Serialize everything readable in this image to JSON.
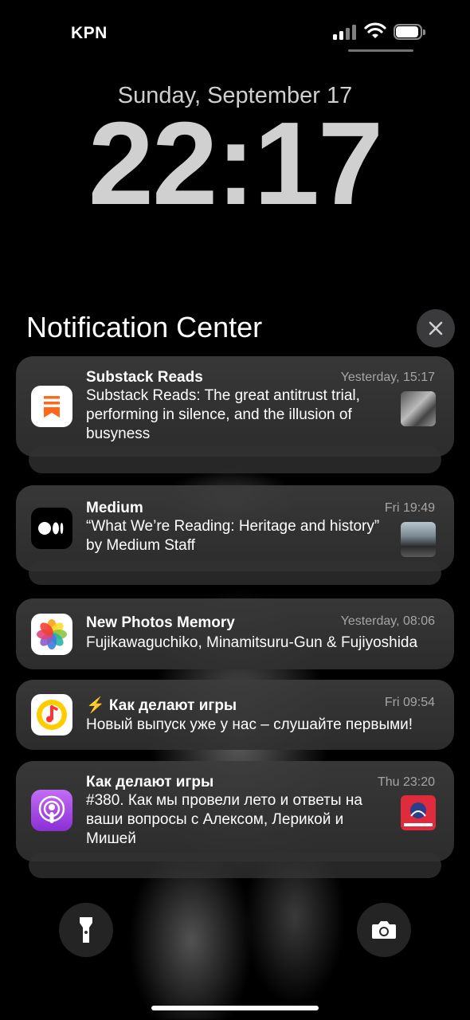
{
  "status_bar": {
    "carrier": "KPN",
    "signal_icon": "cellular-signal-icon",
    "wifi_icon": "wifi-icon",
    "battery_icon": "battery-icon",
    "battery_level": 0.85
  },
  "lock_screen": {
    "date": "Sunday, September 17",
    "time": "22:17"
  },
  "notification_center": {
    "title": "Notification Center",
    "close_icon": "close-icon"
  },
  "notifications": [
    {
      "app": "Substack Reads",
      "icon": "substack-icon",
      "time": "Yesterday, 15:17",
      "body": "Substack Reads: The great antitrust trial, performing in silence, and the illusion of busyness",
      "has_thumbnail": true
    },
    {
      "app": "Medium",
      "icon": "medium-icon",
      "time": "Fri 19:49",
      "body": "“What We’re Reading: Heritage and history” by Medium Staff",
      "has_thumbnail": true
    },
    {
      "app": "New Photos Memory",
      "icon": "photos-icon",
      "time": "Yesterday, 08:06",
      "body": "Fujikawaguchiko, Minamitsuru-Gun & Fujiyoshida",
      "has_thumbnail": false
    },
    {
      "app": "⚡ Как делают игры",
      "icon": "yandex-music-icon",
      "time": "Fri 09:54",
      "body": "Новый выпуск уже у нас – слушайте первыми!",
      "has_thumbnail": false
    },
    {
      "app": "Как делают игры",
      "icon": "podcasts-icon",
      "time": "Thu 23:20",
      "body": "#380. Как мы провели лето и ответы на ваши вопросы с Алексом, Лерикой и Мишей",
      "has_thumbnail": true
    }
  ],
  "bottom_controls": {
    "flashlight_icon": "flashlight-icon",
    "camera_icon": "camera-icon"
  },
  "colors": {
    "background": "#000000",
    "card": "#3a3a3a",
    "secondary_text": "#a5a5a5",
    "substack_orange": "#ff6719",
    "podcasts_purple": "#9b3fe0",
    "yandex_yellow": "#ffcc00"
  }
}
